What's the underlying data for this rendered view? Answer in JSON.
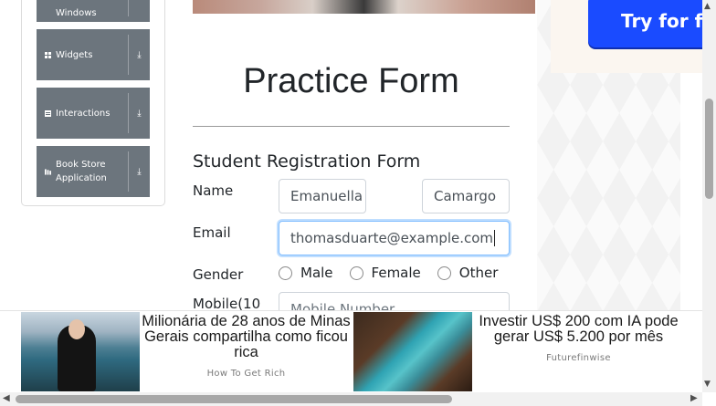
{
  "sidebar": {
    "groups": [
      {
        "label_line1": "Windows",
        "label_line2": ""
      },
      {
        "label_line1": "Widgets",
        "label_line2": ""
      },
      {
        "label_line1": "Interactions",
        "label_line2": ""
      },
      {
        "label_line1": "Book Store",
        "label_line2": "Application"
      }
    ]
  },
  "main": {
    "title": "Practice Form",
    "form_heading": "Student Registration Form",
    "name_label": "Name",
    "first_name_value": "Emanuella",
    "last_name_value": "Camargo",
    "email_label": "Email",
    "email_value": "thomasduarte@example.com",
    "gender_label": "Gender",
    "gender_options": [
      "Male",
      "Female",
      "Other"
    ],
    "mobile_label": "Mobile(10",
    "mobile_placeholder": "Mobile Number"
  },
  "right_ad": {
    "button_text": "Try for fr"
  },
  "bottom_ads": [
    {
      "headline": "Milionária de 28 anos de Minas Gerais compartilha como ficou rica",
      "source": "How To Get Rich"
    },
    {
      "headline": "Investir US$ 200 com IA pode gerar US$ 5.200 por mês",
      "source": "Futurefinwise"
    }
  ],
  "colors": {
    "sidebar_group": "#6c757d",
    "focus_border": "#80bdff",
    "ad_button": "#1a4bff"
  }
}
